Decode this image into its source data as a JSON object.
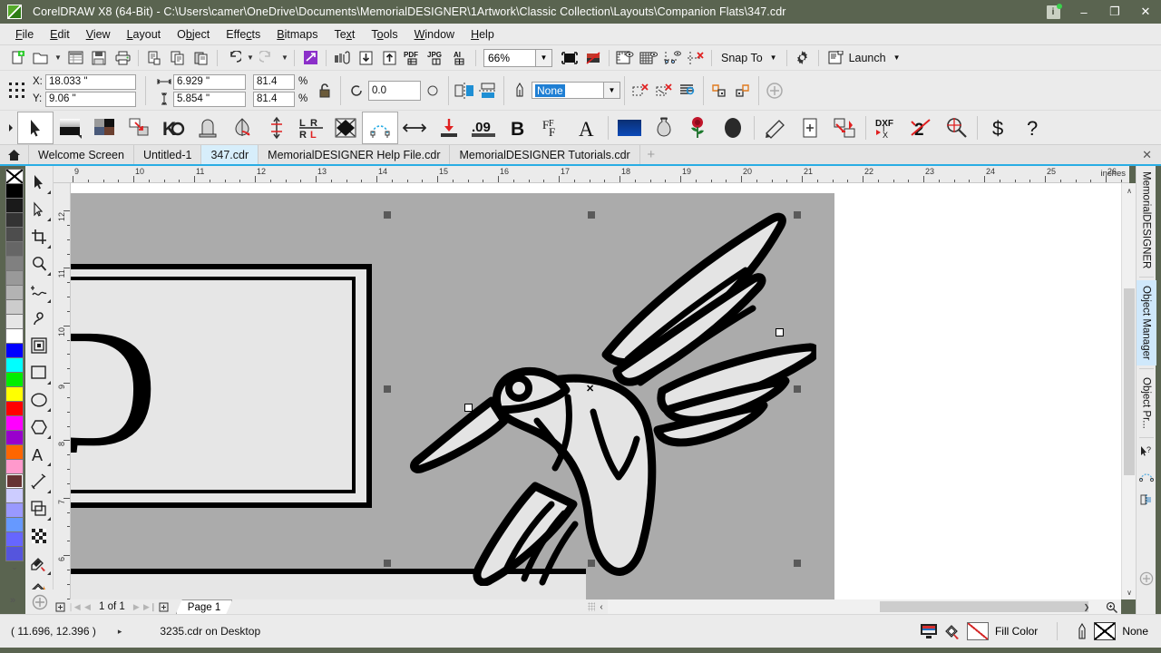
{
  "window": {
    "title": "CorelDRAW X8 (64-Bit) - C:\\Users\\camer\\OneDrive\\Documents\\MemorialDESIGNER\\1Artwork\\Classic Collection\\Layouts\\Companion Flats\\347.cdr",
    "minimize": "–",
    "maximize": "❐",
    "close": "✕",
    "notify": "i"
  },
  "menu": {
    "items": [
      "File",
      "Edit",
      "View",
      "Layout",
      "Object",
      "Effects",
      "Bitmaps",
      "Text",
      "Tools",
      "Window",
      "Help"
    ]
  },
  "toolbar": {
    "zoom_level": "66%",
    "snap_to_label": "Snap To",
    "launch_label": "Launch",
    "buttons": [
      "new-document",
      "open-document",
      "open-dropdown",
      "new-from-template",
      "save",
      "print",
      "print-preview",
      "copy",
      "paste",
      "undo",
      "undo-dropdown",
      "redo",
      "redo-dropdown",
      "publish-to-pdf",
      "import",
      "export",
      "export-pdf",
      "export-jpg",
      "export-ai",
      "fullscreen-preview",
      "hide-bitmaps",
      "view-rulers",
      "view-grid",
      "view-guidelines",
      "clear-guidelines",
      "snap-to",
      "options",
      "launch"
    ]
  },
  "propertybar": {
    "x_label": "X:",
    "y_label": "Y:",
    "x_value": "18.033 \"",
    "y_value": "9.06 \"",
    "width_value": "6.929 \"",
    "height_value": "5.854 \"",
    "scale_x": "81.4",
    "scale_y": "81.4",
    "percent": "%",
    "rotation_value": "0.0",
    "outline_width": "None",
    "lock_ratio_icon": "lock-ratio-icon",
    "mirror_h_icon": "mirror-horizontal-icon",
    "mirror_v_icon": "mirror-vertical-icon"
  },
  "memorial_toolbar": {
    "buttons": [
      "pick-tool",
      "gradient-panel",
      "texture-panel",
      "duplicate-shape",
      "knockout-tool",
      "monument-shape",
      "vase-shape",
      "vertical-align",
      "left-right-align",
      "mirror-shape",
      "arc-nodes",
      "horizontal-size",
      "base-align",
      "decimal-precision",
      "bold-text",
      "font-panel",
      "text-tool",
      "color-fill",
      "vase-library",
      "rose-library",
      "ellipse-shape",
      "shading-tool",
      "add-page",
      "transform-flip",
      "dxf-export",
      "clean-art",
      "zoom-target",
      "price-tool",
      "help-tool"
    ]
  },
  "doctabs": {
    "home_icon": "home-icon",
    "tabs": [
      {
        "label": "Welcome Screen",
        "active": false
      },
      {
        "label": "Untitled-1",
        "active": false
      },
      {
        "label": "347.cdr",
        "active": true
      },
      {
        "label": "MemorialDESIGNER Help File.cdr",
        "active": false
      },
      {
        "label": "MemorialDESIGNER Tutorials.cdr",
        "active": false
      }
    ],
    "add_tab": "+",
    "close_tabs": "✕"
  },
  "toolbox": {
    "tools": [
      "pick-tool",
      "shape-tool",
      "crop-tool",
      "zoom-tool",
      "freehand-tool",
      "artistic-media-tool",
      "smart-fill-tool",
      "rectangle-tool",
      "ellipse-tool",
      "polygon-tool",
      "text-tool",
      "dimension-tool",
      "connector-tool",
      "drop-shadow-tool",
      "transparency-tool",
      "color-eyedropper-tool",
      "interactive-fill-tool"
    ]
  },
  "palette": {
    "none_swatch": "no-color",
    "colors": [
      "#000000",
      "#1a1a1a",
      "#333333",
      "#4d4d4d",
      "#666666",
      "#808080",
      "#999999",
      "#b3b3b3",
      "#cccccc",
      "#e6e6e6",
      "#ffffff",
      "#0000ff",
      "#00ffff",
      "#00ee00",
      "#ffff00",
      "#ff0000",
      "#ff00ff",
      "#9900cc",
      "#ff6600",
      "#ff99cc",
      "#663333",
      "#ccccff",
      "#9999ff",
      "#6699ff",
      "#6666ff",
      "#5555dd"
    ],
    "selected_index": 20,
    "scroll_down": "⌄",
    "expand": "»"
  },
  "rulers": {
    "unit_label": "inches",
    "h_labels": [
      "9",
      "10",
      "11",
      "12",
      "13",
      "14",
      "15",
      "16",
      "17",
      "18",
      "19",
      "20",
      "21",
      "22",
      "23",
      "24",
      "25",
      "26"
    ],
    "v_labels": [
      "12",
      "11",
      "10",
      "9",
      "8",
      "7",
      "6"
    ]
  },
  "canvas": {
    "letter": "D",
    "artwork_name": "hummingbird-artwork",
    "page_background": "#ababab",
    "plaque_fill": "#e6e6e6",
    "selection_handle_color": "#5a5a5a"
  },
  "docker": {
    "title_tab": "MemorialDESIGNER",
    "object_manager": "Object Manager",
    "object_properties": "Object Pr...",
    "icons": [
      "pick-help-icon",
      "arc-nodes-icon",
      "align-icon",
      "quick-add-icon"
    ]
  },
  "pagenav": {
    "add_page_before": "add-page-before",
    "first": "❘◀",
    "prev": "◀",
    "counter": "1 of 1",
    "next": "▶",
    "last": "▶❙",
    "add_page_after": "add-page-after",
    "page_tab": "Page 1",
    "collapse": "‹"
  },
  "statusbar": {
    "coordinates": "( 11.696, 12.396 )",
    "arrow": "▸",
    "filename": "3235.cdr on Desktop",
    "fill_label": "Fill Color",
    "outline_label": "None",
    "screen_icon": "screen-color-icon",
    "fill_icon": "fill-bucket-icon",
    "outline_icon": "outline-pen-icon"
  },
  "scroll": {
    "v_up": "∧",
    "v_down": "∨",
    "h_right": "❯",
    "zoom_corner": "zoom-corner-icon"
  }
}
